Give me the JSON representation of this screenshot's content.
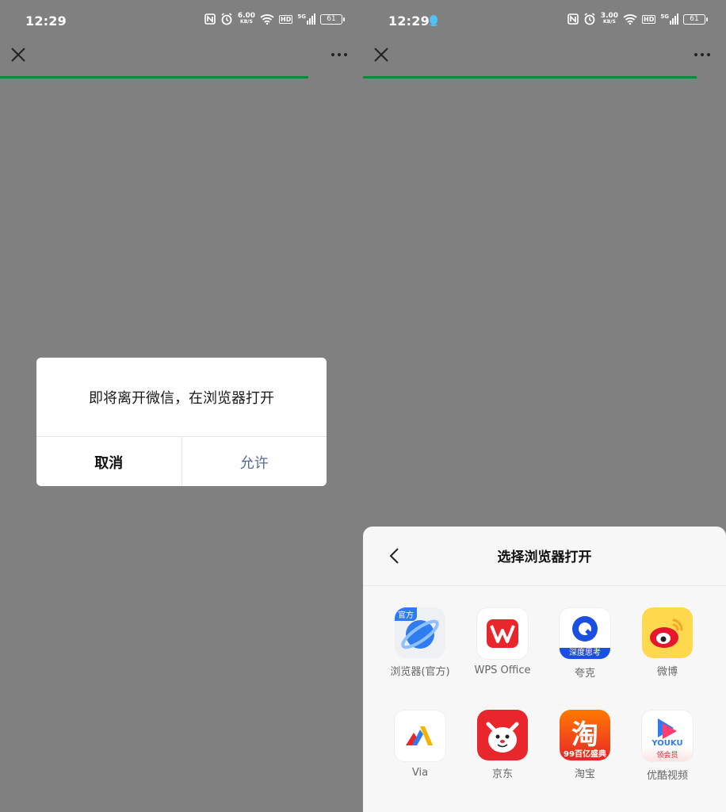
{
  "left": {
    "status": {
      "time": "12:29",
      "net_speed": "6.00",
      "net_unit": "KB/S",
      "hd": "HD",
      "signal_gen": "5G",
      "battery": "61"
    },
    "dialog": {
      "message": "即将离开微信，在浏览器打开",
      "cancel_label": "取消",
      "allow_label": "允许"
    }
  },
  "right": {
    "status": {
      "time": "12:29",
      "net_speed": "3.00",
      "net_unit": "KB/S",
      "hd": "HD",
      "signal_gen": "5G",
      "battery": "61"
    },
    "sheet": {
      "title": "选择浏览器打开",
      "apps": [
        {
          "label": "浏览器(官方)",
          "icon": "browser-official-icon",
          "badge": "官方"
        },
        {
          "label": "WPS Office",
          "icon": "wps-office-icon"
        },
        {
          "label": "夸克",
          "icon": "quark-icon",
          "badge": "深度思考"
        },
        {
          "label": "微博",
          "icon": "weibo-icon"
        },
        {
          "label": "Via",
          "icon": "via-icon"
        },
        {
          "label": "京东",
          "icon": "jd-icon"
        },
        {
          "label": "淘宝",
          "icon": "taobao-icon",
          "badge": "99百亿盛典",
          "glyph": "淘"
        },
        {
          "label": "优酷视频",
          "icon": "youku-icon",
          "badge": "YOUKU",
          "badge2": "领会员"
        }
      ]
    }
  },
  "colors": {
    "overlay": "#808080",
    "progress": "#0a8a3a",
    "dialog_allow": "#576b95",
    "sheet_bg": "#f7f7f7"
  }
}
